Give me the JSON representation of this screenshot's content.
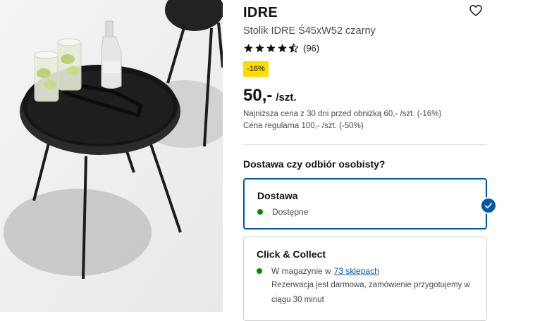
{
  "product": {
    "name": "IDRE",
    "description": "Stolik IDRE Ś45xW52 czarny",
    "rating_value": 4.5,
    "rating_count": "(96)",
    "discount_badge": "-16%",
    "price_amount": "50,-",
    "price_unit": "/szt.",
    "lowest_price_note": "Najniższa cena z 30 dni przed obniżką 60,- /szt. (-16%)",
    "regular_price_note": "Cena regularna 100,- /szt. (-50%)"
  },
  "icons": {
    "favorite": "heart-icon",
    "star": "star-icon",
    "selected": "check-icon"
  },
  "colors": {
    "badge": "#ffdb00",
    "accent_blue": "#0058a3",
    "available_green": "#0a8a00"
  },
  "delivery": {
    "section_title": "Dostawa czy odbiór osobisty?",
    "options": [
      {
        "title": "Dostawa",
        "status": "Dostępne",
        "selected": true
      },
      {
        "title": "Click & Collect",
        "status_prefix": "W magazynie w",
        "stores_link": "73 sklepach",
        "note": "Rezerwacja jest darmowa, zamówienie przygotujemy w ciągu 30 minut",
        "selected": false
      }
    ]
  }
}
